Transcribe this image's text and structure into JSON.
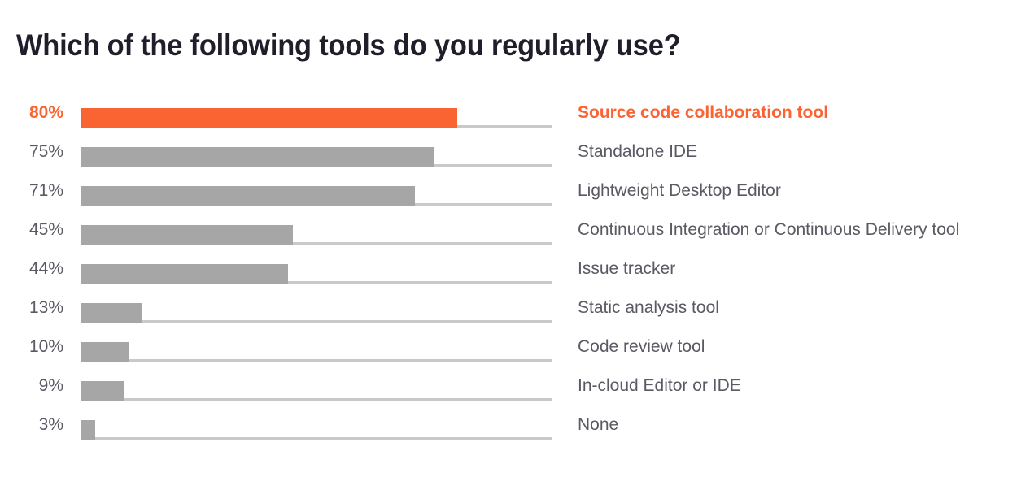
{
  "chart_data": {
    "type": "bar",
    "title": "Which of the following tools do you regularly use?",
    "subtitle": "",
    "xlabel": "",
    "ylabel": "",
    "orientation": "horizontal",
    "grid": false,
    "legend": false,
    "xlim": [
      0,
      100
    ],
    "value_suffix": "%",
    "categories": [
      "Source code collaboration tool",
      "Standalone IDE",
      "Lightweight Desktop Editor",
      "Continuous Integration or Continuous Delivery tool",
      "Issue tracker",
      "Static analysis tool",
      "Code review tool",
      "In-cloud Editor or IDE",
      "None"
    ],
    "values": [
      80,
      75,
      71,
      45,
      44,
      13,
      10,
      9,
      3
    ],
    "value_labels": [
      "80%",
      "75%",
      "71%",
      "45%",
      "44%",
      "13%",
      "10%",
      "9%",
      "3%"
    ],
    "highlight_index": 0,
    "colors": {
      "highlight": "#fa6432",
      "bar": "#a6a6a6",
      "track": "#c9c9c9",
      "label": "#5a5a64",
      "title": "#1f1f2b",
      "background": "#ffffff"
    }
  },
  "rows": [
    {
      "value_label": "80%",
      "value": 80,
      "category": "Source code collaboration tool",
      "highlight": true
    },
    {
      "value_label": "75%",
      "value": 75,
      "category": "Standalone IDE",
      "highlight": false
    },
    {
      "value_label": "71%",
      "value": 71,
      "category": "Lightweight Desktop Editor",
      "highlight": false
    },
    {
      "value_label": "45%",
      "value": 45,
      "category": "Continuous Integration or Continuous Delivery tool",
      "highlight": false
    },
    {
      "value_label": "44%",
      "value": 44,
      "category": "Issue tracker",
      "highlight": false
    },
    {
      "value_label": "13%",
      "value": 13,
      "category": "Static analysis tool",
      "highlight": false
    },
    {
      "value_label": "10%",
      "value": 10,
      "category": "Code review tool",
      "highlight": false
    },
    {
      "value_label": "9%",
      "value": 9,
      "category": "In-cloud Editor or IDE",
      "highlight": false
    },
    {
      "value_label": "3%",
      "value": 3,
      "category": "None",
      "highlight": false
    }
  ]
}
